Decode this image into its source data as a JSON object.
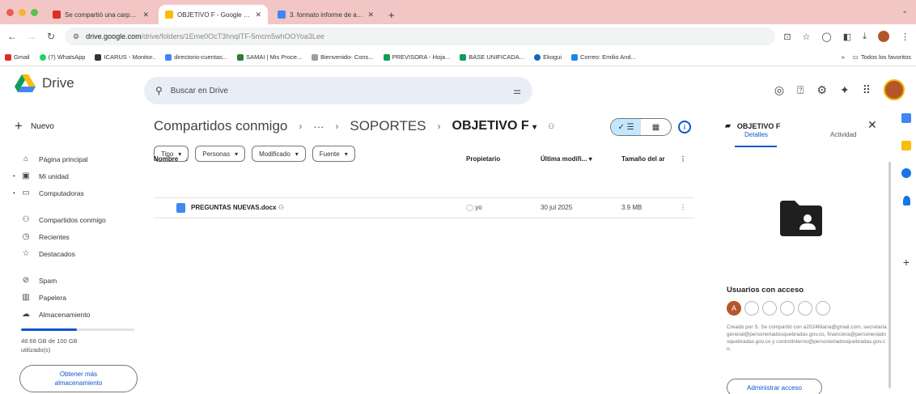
{
  "browser": {
    "tabs": [
      {
        "title": "Se compartió una carpeta c",
        "icon": "gmail-icon",
        "color": "#d93025"
      },
      {
        "title": "OBJETIVO F - Google Drive",
        "icon": "drive-icon",
        "color": "#fbbc04"
      },
      {
        "title": "3. formato informe de activi",
        "icon": "docs-icon",
        "color": "#4285f4"
      }
    ],
    "new_tab": "+",
    "url_host": "drive.google.com",
    "url_rest": "/drive/folders/1Eme0OcT3hnqITF-5mcm5whOOYoa3Lee",
    "bookmarks": [
      {
        "label": "Gmail",
        "color": "#d93025"
      },
      {
        "label": "(7) WhatsApp",
        "color": "#25d366"
      },
      {
        "label": "ICARUS - Monitor..",
        "color": "#333333"
      },
      {
        "label": "directorio-cuentas...",
        "color": "#4285f4"
      },
      {
        "label": "SAMAI | Mis Proce...",
        "color": "#2e7d32"
      },
      {
        "label": "Bienvenido- Cons...",
        "color": "#9e9e9e"
      },
      {
        "label": "PREVISORA - Hoja...",
        "color": "#0f9d58"
      },
      {
        "label": "BASE UNIFICADA...",
        "color": "#0f9d58"
      },
      {
        "label": "Ekogui",
        "color": "#1565c0"
      },
      {
        "label": "Correo: Emilio And...",
        "color": "#1e88e5"
      }
    ],
    "all_bookmarks": "Todos los favoritos"
  },
  "drive": {
    "logo_text": "Drive",
    "search_placeholder": "Buscar en Drive",
    "new_button": "Nuevo",
    "nav": [
      {
        "label": "Página principal",
        "icon": "home-icon",
        "glyph": "⌂",
        "caret": false
      },
      {
        "label": "Mi unidad",
        "icon": "drive-folder-icon",
        "glyph": "▣",
        "caret": true
      },
      {
        "label": "Computadoras",
        "icon": "computer-icon",
        "glyph": "⌨",
        "caret": true
      },
      {
        "label": "Compartidos conmigo",
        "icon": "shared-icon",
        "glyph": "👥",
        "caret": false
      },
      {
        "label": "Recientes",
        "icon": "clock-icon",
        "glyph": "◷",
        "caret": false
      },
      {
        "label": "Destacados",
        "icon": "star-icon",
        "glyph": "☆",
        "caret": false
      },
      {
        "label": "Spam",
        "icon": "spam-icon",
        "glyph": "⊘",
        "caret": false
      },
      {
        "label": "Papelera",
        "icon": "trash-icon",
        "glyph": "🗑",
        "caret": false
      },
      {
        "label": "Almacenamiento",
        "icon": "cloud-icon",
        "glyph": "☁",
        "caret": false
      }
    ],
    "storage_used_fraction": 0.49,
    "storage_text": "48.68 GB de 100 GB utilizado(s)",
    "more_storage": "Obtener más almacenamiento",
    "breadcrumb": {
      "root": "Compartidos conmigo",
      "ellipsis": "···",
      "middle": "SOPORTES",
      "current": "OBJETIVO F"
    },
    "filters": [
      "Tipo",
      "Personas",
      "Modificado",
      "Fuente"
    ],
    "columns": {
      "name": "Nombre",
      "owner": "Propietario",
      "modified": "Última modifi...",
      "size": "Tamaño del ar"
    },
    "files": [
      {
        "name": "PREGUNTAS NUEVAS.docx",
        "owner": "yo",
        "modified": "30 jul 2025",
        "size": "3.9 MB"
      }
    ],
    "details": {
      "title": "OBJETIVO F",
      "tab_details": "Detalles",
      "tab_activity": "Actividad",
      "users_title": "Usuarios con acceso",
      "avatar_letter": "A",
      "note": "Creado por S. Se compartió con a2024liliana@gmail.com, secretariageneral@personeriadosquebradas.gov.co, financiera@personeriadosquebradas.gov.co y controlinterno@personeriadosquebradas.gov.co.",
      "manage_button": "Administrar acceso"
    }
  }
}
